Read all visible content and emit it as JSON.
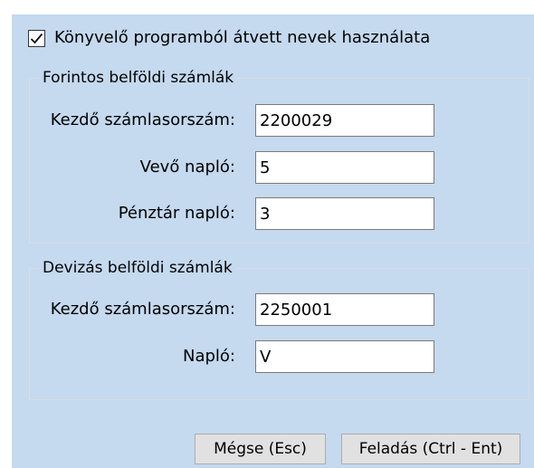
{
  "use_accounting_names": {
    "label": "Könyvelő programból átvett nevek használata",
    "checked": true
  },
  "huf_domestic": {
    "title": "Forintos belföldi számlák",
    "start_number_label": "Kezdő számlasorszám:",
    "start_number_value": "2200029",
    "customer_journal_label": "Vevő napló:",
    "customer_journal_value": "5",
    "cash_journal_label": "Pénztár napló:",
    "cash_journal_value": "3"
  },
  "fx_domestic": {
    "title": "Devizás belföldi számlák",
    "start_number_label": "Kezdő számlasorszám:",
    "start_number_value": "2250001",
    "journal_label": "Napló:",
    "journal_value": "V"
  },
  "buttons": {
    "cancel": "Mégse (Esc)",
    "submit": "Feladás (Ctrl - Ent)"
  }
}
